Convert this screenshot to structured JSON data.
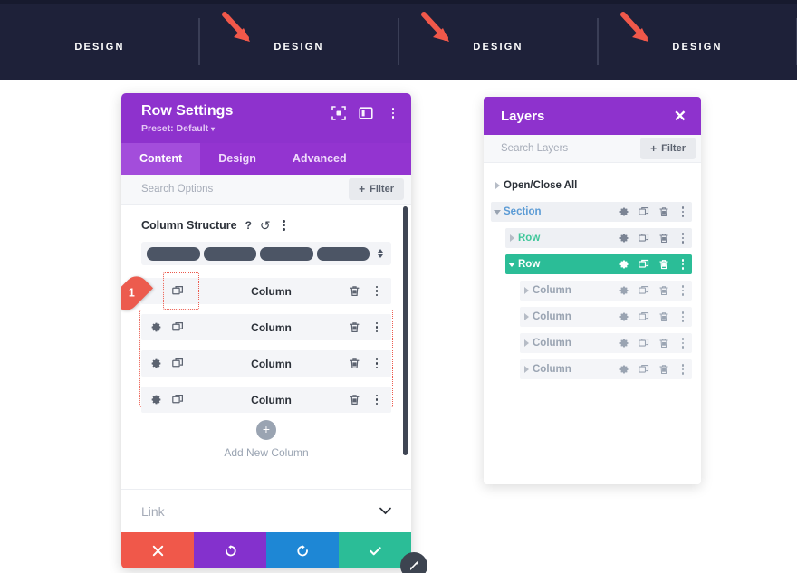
{
  "banner": {
    "columns": [
      {
        "label": "DESIGN",
        "arrow": false
      },
      {
        "label": "DESIGN",
        "arrow": true
      },
      {
        "label": "DESIGN",
        "arrow": true
      },
      {
        "label": "DESIGN",
        "arrow": true
      }
    ],
    "background_color": "#1e2139",
    "arrow_color": "#f0584a"
  },
  "row_settings": {
    "title": "Row Settings",
    "preset_label": "Preset: Default",
    "preset_caret": "▾",
    "header_icons": [
      "focus-icon",
      "layout-icon",
      "more-options-icon"
    ],
    "tabs": [
      {
        "label": "Content",
        "active": true
      },
      {
        "label": "Design",
        "active": false
      },
      {
        "label": "Advanced",
        "active": false
      }
    ],
    "search_placeholder": "Search Options",
    "filter_button": {
      "plus": "+",
      "label": "Filter"
    },
    "column_structure": {
      "label": "Column Structure",
      "help_icon": "?",
      "reset_icon": "↺",
      "more_icon": "more-options-icon",
      "bars": 4
    },
    "columns": [
      {
        "label": "Column",
        "has_gear": false,
        "highlighted": true
      },
      {
        "label": "Column",
        "has_gear": true,
        "highlighted": false
      },
      {
        "label": "Column",
        "has_gear": true,
        "highlighted": false
      },
      {
        "label": "Column",
        "has_gear": true,
        "highlighted": false
      }
    ],
    "step_badge": "1",
    "add_new_column": {
      "icon": "+",
      "label": "Add New Column"
    },
    "link_section": {
      "label": "Link",
      "chevron": "⌄"
    },
    "footer_buttons": [
      {
        "name": "cancel",
        "icon": "✖",
        "color": "#f0584a"
      },
      {
        "name": "undo",
        "icon": "↺",
        "color": "#8431cd"
      },
      {
        "name": "redo",
        "icon": "↻",
        "color": "#1e87d5"
      },
      {
        "name": "save",
        "icon": "✔",
        "color": "#2bbd97"
      }
    ],
    "header_color": "#8e32cd",
    "tabs_color": "#9334d0",
    "active_tab_color": "#a34ddb"
  },
  "layers": {
    "title": "Layers",
    "close_icon": "✕",
    "search_placeholder": "Search Layers",
    "filter_button": {
      "plus": "+",
      "label": "Filter"
    },
    "tree": [
      {
        "label": "Open/Close All",
        "type": "openclose",
        "indent": 0,
        "triangle": "right",
        "icons": false
      },
      {
        "label": "Section",
        "type": "section",
        "indent": 0,
        "triangle": "down",
        "icons": true
      },
      {
        "label": "Row",
        "type": "row",
        "indent": 1,
        "triangle": "right",
        "icons": true
      },
      {
        "label": "Row",
        "type": "row-selected",
        "indent": 1,
        "triangle": "down",
        "icons": true
      },
      {
        "label": "Column",
        "type": "column",
        "indent": 2,
        "triangle": "right",
        "icons": true
      },
      {
        "label": "Column",
        "type": "column",
        "indent": 2,
        "triangle": "right",
        "icons": true
      },
      {
        "label": "Column",
        "type": "column",
        "indent": 2,
        "triangle": "right",
        "icons": true
      },
      {
        "label": "Column",
        "type": "column",
        "indent": 2,
        "triangle": "right",
        "icons": true
      }
    ],
    "header_color": "#8e32cd",
    "selected_color": "#2bbd97"
  },
  "resize_handle": "resize-handle-icon"
}
